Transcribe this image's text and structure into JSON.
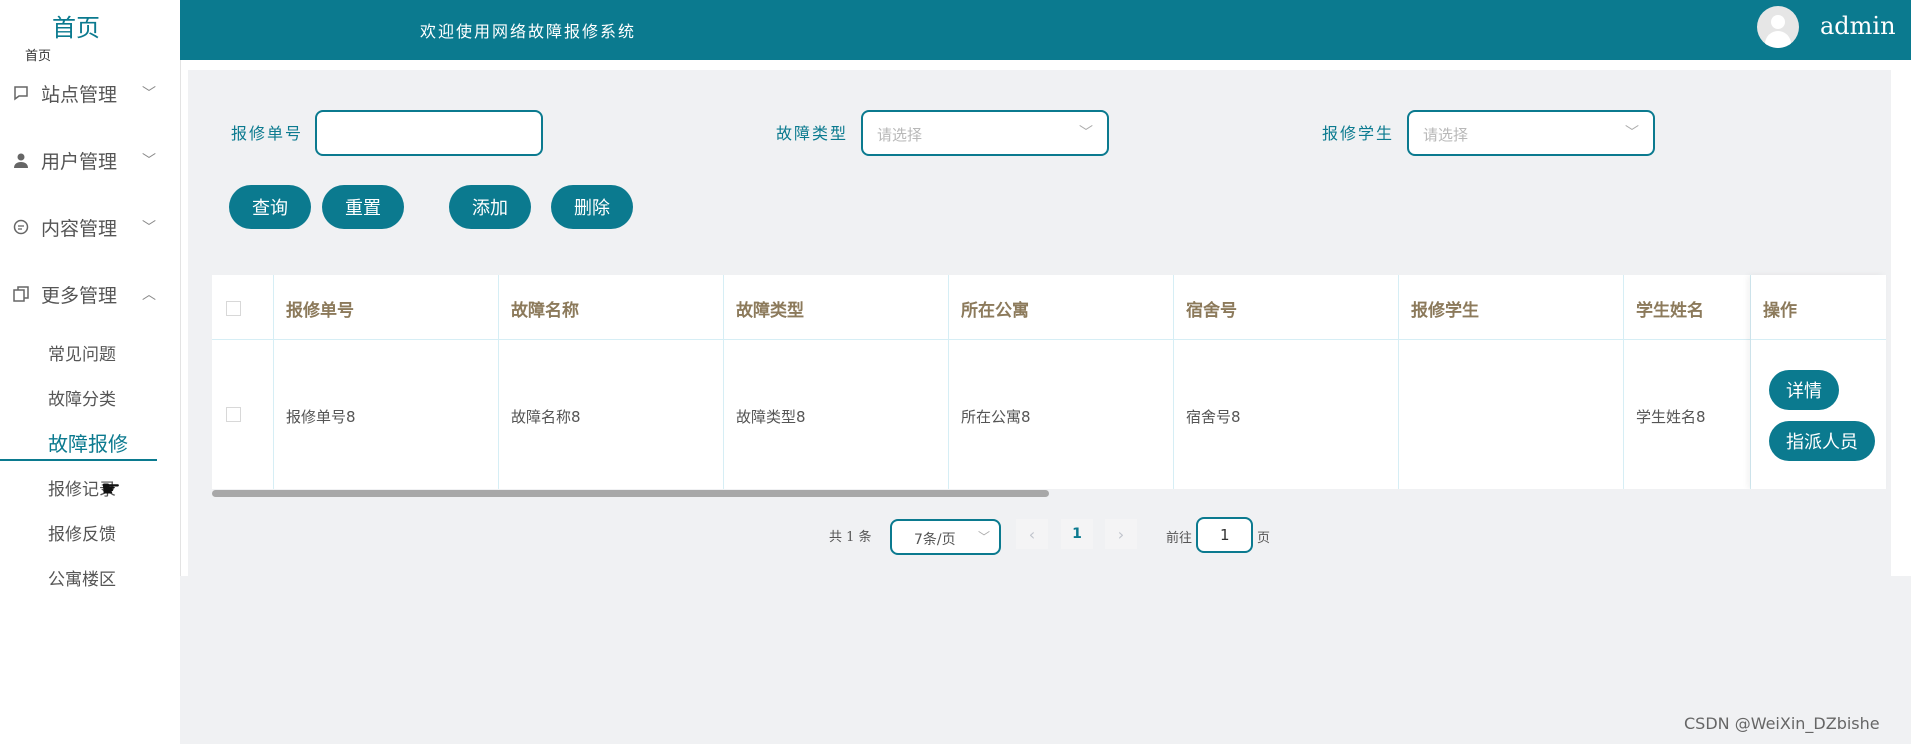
{
  "sidebar": {
    "home": "首页",
    "breadcrumb": "首页",
    "menus": [
      {
        "label": "站点管理",
        "icon": "message-square-icon",
        "expanded": false
      },
      {
        "label": "用户管理",
        "icon": "user-icon",
        "expanded": false
      },
      {
        "label": "内容管理",
        "icon": "chat-bubble-icon",
        "expanded": false
      },
      {
        "label": "更多管理",
        "icon": "copy-icon",
        "expanded": true
      }
    ],
    "sub_items": [
      "常见问题",
      "故障分类",
      "故障报修",
      "报修记录",
      "报修反馈",
      "公寓楼区"
    ],
    "active_sub": "故障报修"
  },
  "header": {
    "welcome": "欢迎使用网络故障报修系统",
    "username": "admin"
  },
  "search": {
    "order_label": "报修单号",
    "order_value": "",
    "type_label": "故障类型",
    "type_placeholder": "请选择",
    "student_label": "报修学生",
    "student_placeholder": "请选择",
    "query": "查询",
    "reset": "重置",
    "add": "添加",
    "delete": "删除"
  },
  "table": {
    "columns": [
      "报修单号",
      "故障名称",
      "故障类型",
      "所在公寓",
      "宿舍号",
      "报修学生",
      "学生姓名",
      "操作"
    ],
    "rows": [
      {
        "cells": [
          "报修单号8",
          "故障名称8",
          "故障类型8",
          "所在公寓8",
          "宿舍号8",
          "",
          "学生姓名8"
        ]
      }
    ],
    "detail_btn": "详情",
    "assign_btn": "指派人员"
  },
  "pagination": {
    "total": "共 1 条",
    "page_size": "7条/页",
    "current": "1",
    "goto_label": "前往",
    "goto_value": "1",
    "page_suffix": "页"
  },
  "watermark": "CSDN @WeiXin_DZbishe",
  "colors": {
    "accent": "#0b7a8f",
    "header_text": "#8c7a5b"
  }
}
